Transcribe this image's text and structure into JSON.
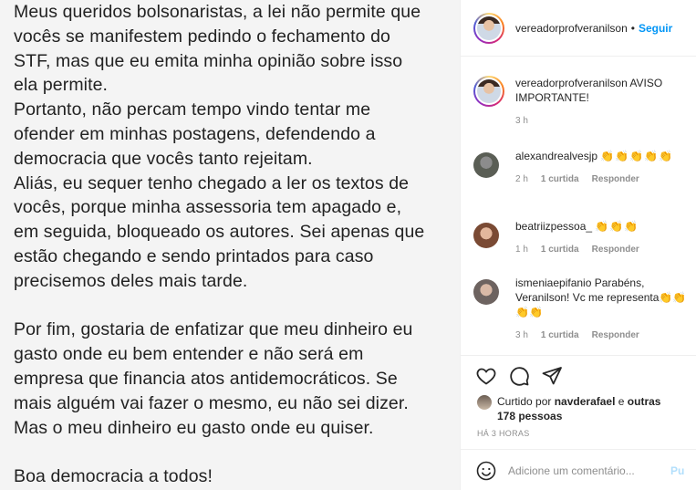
{
  "post": {
    "lines": [
      "Meus queridos bolsonaristas, a lei não permite que",
      "vocês se manifestem pedindo o fechamento do",
      "STF, mas que eu emita minha opinião sobre isso",
      "ela permite.",
      "Portanto, não percam tempo vindo tentar me",
      "ofender em minhas postagens, defendendo a",
      "democracia que vocês tanto rejeitam.",
      "Aliás, eu sequer tenho chegado a ler os textos de",
      "vocês, porque minha assessoria tem  apagado e,",
      "em seguida, bloqueado os autores. Sei apenas que",
      "estão chegando e sendo printados para caso",
      "precisemos deles mais tarde.",
      "",
      "Por fim, gostaria de enfatizar que meu dinheiro eu",
      "gasto onde eu bem entender e não será em",
      "empresa que financia atos antidemocráticos. Se",
      "mais alguém vai fazer o mesmo, eu não sei dizer.",
      "Mas o meu dinheiro eu gasto onde eu quiser.",
      "",
      "Boa democracia a todos!"
    ]
  },
  "header": {
    "username": "vereadorprofveranilson",
    "separator": "•",
    "follow_label": "Seguir"
  },
  "caption": {
    "username": "vereadorprofveranilson",
    "text": "AVISO IMPORTANTE!",
    "time": "3 h"
  },
  "comments": [
    {
      "username": "alexandrealvesjp",
      "text": "👏👏👏👏👏",
      "time": "2 h",
      "likes": "1 curtida",
      "reply": "Responder"
    },
    {
      "username": "beatriizpessoa_",
      "text": "👏👏👏",
      "time": "1 h",
      "likes": "1 curtida",
      "reply": "Responder"
    },
    {
      "username": "ismeniaepifanio",
      "text": "Parabéns, Veranilson! Vc me representa👏👏👏👏",
      "time": "3 h",
      "likes": "1 curtida",
      "reply": "Responder"
    }
  ],
  "likes": {
    "prefix": "Curtido por",
    "user": "navderafael",
    "joiner": "e",
    "others": "outras 178 pessoas"
  },
  "time_ago": "HÁ 3 HORAS",
  "add_comment": {
    "placeholder": "Adicione um comentário...",
    "publish_label": "Pu"
  },
  "icons": {
    "like": "heart-icon",
    "comment": "comment-icon",
    "share": "paper-plane-icon",
    "emoji": "smiley-icon"
  },
  "colors": {
    "link": "#0095f6",
    "muted": "#8e8e8e",
    "publish_disabled": "#b2dffc"
  }
}
